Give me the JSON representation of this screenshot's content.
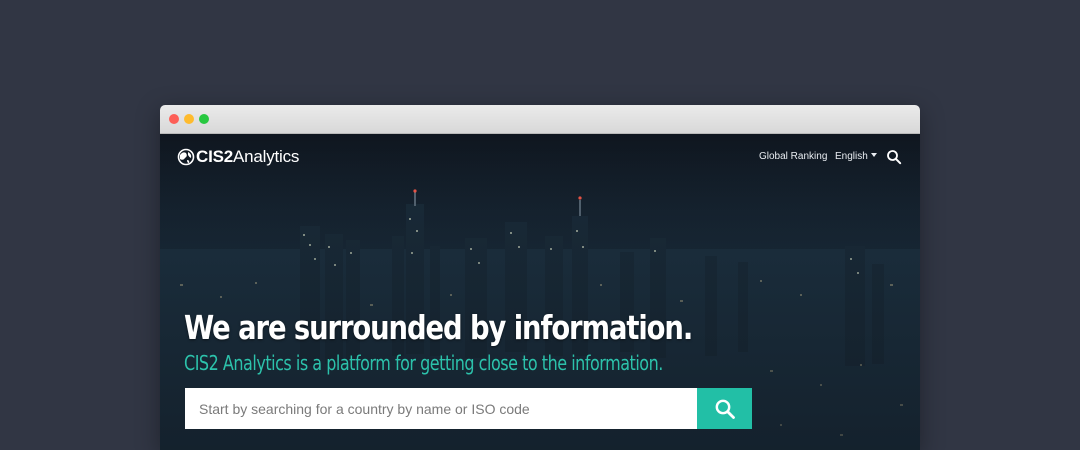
{
  "logo": {
    "bold": "CIS2",
    "light": "Analytics"
  },
  "nav": {
    "ranking": "Global Ranking",
    "language": "English",
    "search_icon": "search-icon"
  },
  "hero": {
    "title": "We are surrounded by information.",
    "subtitle": "CIS2 Analytics is a platform for getting close to the information."
  },
  "search": {
    "placeholder": "Start by searching for a country by name or ISO code",
    "value": "",
    "button_icon": "search-icon"
  },
  "window_controls": [
    "close",
    "minimize",
    "zoom"
  ],
  "colors": {
    "page_background": "#313644",
    "accent": "#22bfa6",
    "subtitle": "#2cc2ab",
    "title": "#ffffff"
  }
}
